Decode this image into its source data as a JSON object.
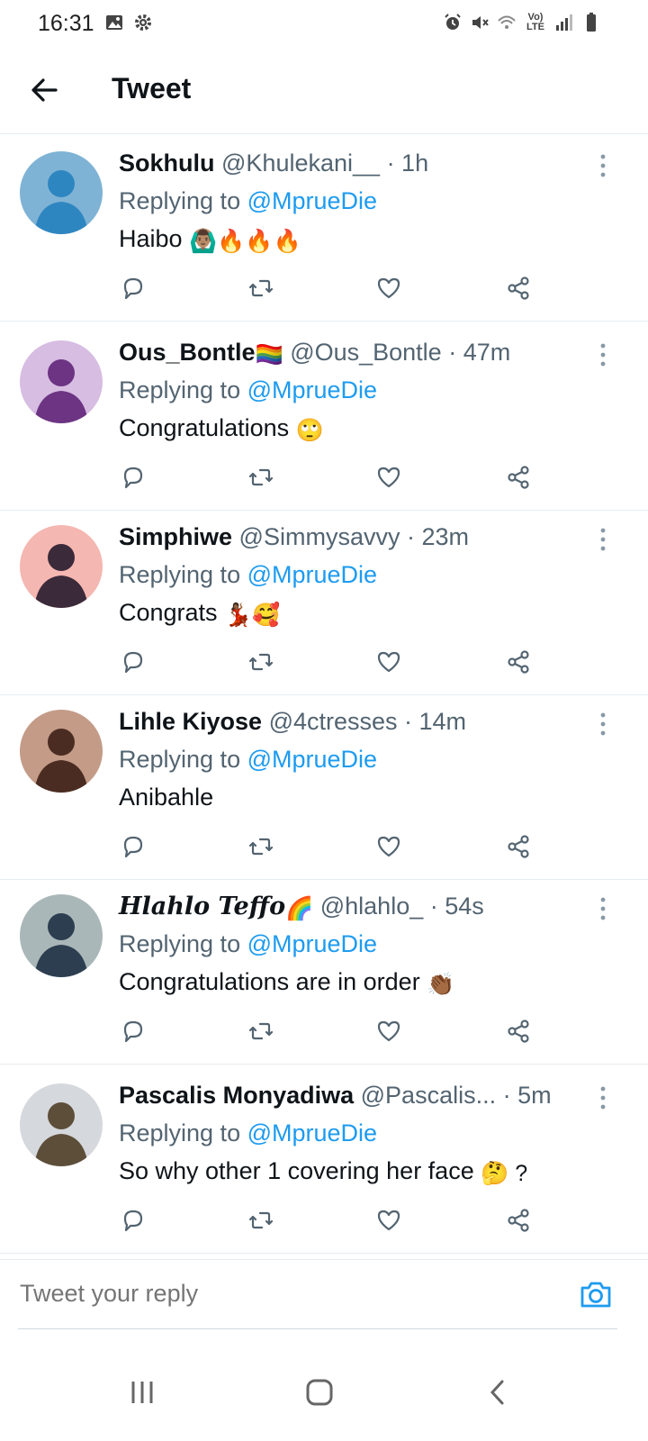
{
  "status_bar": {
    "time": "16:31",
    "network": "Vo) LTE",
    "icons": [
      "gallery-icon",
      "settings-icon",
      "alarm-icon",
      "mute-icon",
      "wifi-icon",
      "signal-icon",
      "battery-icon"
    ]
  },
  "header": {
    "title": "Tweet",
    "back_icon": "arrow-left-icon"
  },
  "colors": {
    "accent": "#1d9bf0",
    "text": "#0f1419",
    "muted": "#536471",
    "divider": "#e6ecf0"
  },
  "tweets": [
    {
      "name": "Sokhulu",
      "name_suffix": "",
      "handle": "@Khulekani__",
      "time": "· 1h",
      "replying_label": "Replying to",
      "mention": "@MprueDie",
      "text": "Haibo",
      "emoji": "🙆🏽‍♂️🔥🔥🔥"
    },
    {
      "name": "Ous_Bontle",
      "name_suffix": "🏳️‍🌈",
      "handle": "@Ous_Bontle",
      "time": "· 47m",
      "replying_label": "Replying to",
      "mention": "@MprueDie",
      "text": "Congratulations",
      "emoji": "🙄"
    },
    {
      "name": "Simphiwe",
      "name_suffix": "",
      "handle": "@Simmysavvy",
      "time": "· 23m",
      "replying_label": "Replying to",
      "mention": "@MprueDie",
      "text": "Congrats",
      "emoji": "💃🏾🥰"
    },
    {
      "name": "Lihle Kiyose",
      "name_suffix": "",
      "handle": "@4ctresses",
      "time": "· 14m",
      "replying_label": "Replying to",
      "mention": "@MprueDie",
      "text": "Anibahle",
      "emoji": ""
    },
    {
      "name": "Hlahlo Teffo",
      "name_suffix": "🌈",
      "handle": "@hlahlo_",
      "time": "· 54s",
      "replying_label": "Replying to",
      "mention": "@MprueDie",
      "text": "Congratulations are in order",
      "emoji": "👏🏾"
    },
    {
      "name": "Pascalis Monyadiwa",
      "name_suffix": "",
      "handle": "@Pascalis...",
      "time": "· 5m",
      "replying_label": "Replying to",
      "mention": "@MprueDie",
      "text": "So why other 1 covering her face",
      "emoji": "🤔 ?"
    }
  ],
  "reply_bar": {
    "placeholder": "Tweet your reply",
    "camera_icon": "camera-icon"
  },
  "nav_bar": {
    "icons": [
      "recent-apps-icon",
      "home-icon",
      "back-icon"
    ]
  }
}
